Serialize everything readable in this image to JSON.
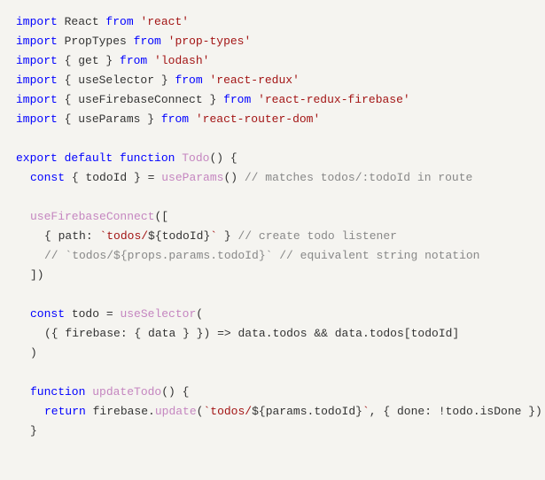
{
  "code": {
    "l1_kw1": "import",
    "l1_name": " React ",
    "l1_kw2": "from",
    "l1_str": " 'react'",
    "l2_kw1": "import",
    "l2_name": " PropTypes ",
    "l2_kw2": "from",
    "l2_str": " 'prop-types'",
    "l3_kw1": "import",
    "l3_p1": " { ",
    "l3_name": "get",
    "l3_p2": " } ",
    "l3_kw2": "from",
    "l3_str": " 'lodash'",
    "l4_kw1": "import",
    "l4_p1": " { ",
    "l4_name": "useSelector",
    "l4_p2": " } ",
    "l4_kw2": "from",
    "l4_str": " 'react-redux'",
    "l5_kw1": "import",
    "l5_p1": " { ",
    "l5_name": "useFirebaseConnect",
    "l5_p2": " } ",
    "l5_kw2": "from",
    "l5_str": " 'react-redux-firebase'",
    "l6_kw1": "import",
    "l6_p1": " { ",
    "l6_name": "useParams",
    "l6_p2": " } ",
    "l6_kw2": "from",
    "l6_str": " 'react-router-dom'",
    "l7_kw1": "export",
    "l7_kw2": " default",
    "l7_kw3": " function",
    "l7_fn": " Todo",
    "l7_p": "() {",
    "l8_kw": "const",
    "l8_p1": " { ",
    "l8_name": "todoId",
    "l8_p2": " } = ",
    "l8_fn": "useParams",
    "l8_p3": "() ",
    "l8_comment": "// matches todos/:todoId in route",
    "l9_fn": "useFirebaseConnect",
    "l9_p": "([",
    "l10_p1": "{ ",
    "l10_prop": "path",
    "l10_p2": ": ",
    "l10_str1": "`todos/",
    "l10_p3": "${",
    "l10_var": "todoId",
    "l10_p4": "}",
    "l10_str2": "`",
    "l10_p5": " } ",
    "l10_comment": "// create todo listener",
    "l11_comment": "// `todos/${props.params.todoId}` // equivalent string notation",
    "l12_p": "])",
    "l13_kw": "const",
    "l13_name": " todo",
    "l13_p1": " = ",
    "l13_fn": "useSelector",
    "l13_p2": "(",
    "l14_p1": "({ ",
    "l14_prop1": "firebase",
    "l14_p2": ": { ",
    "l14_prop2": "data",
    "l14_p3": " } }) => ",
    "l14_v1": "data",
    "l14_p4": ".",
    "l14_v2": "todos",
    "l14_p5": " && ",
    "l14_v3": "data",
    "l14_p6": ".",
    "l14_v4": "todos",
    "l14_p7": "[",
    "l14_v5": "todoId",
    "l14_p8": "]",
    "l15_p": ")",
    "l16_kw": "function",
    "l16_fn": " updateTodo",
    "l16_p": "() {",
    "l17_kw": "return",
    "l17_v1": " firebase",
    "l17_p1": ".",
    "l17_fn": "update",
    "l17_p2": "(",
    "l17_str1": "`todos/",
    "l17_p3": "${",
    "l17_v2": "params",
    "l17_p4": ".",
    "l17_v3": "todoId",
    "l17_p5": "}",
    "l17_str2": "`",
    "l17_p6": ", { ",
    "l17_prop": "done",
    "l17_p7": ": !",
    "l17_v4": "todo",
    "l17_p8": ".",
    "l17_v5": "isDone",
    "l17_p9": " })",
    "l18_p": "}"
  }
}
